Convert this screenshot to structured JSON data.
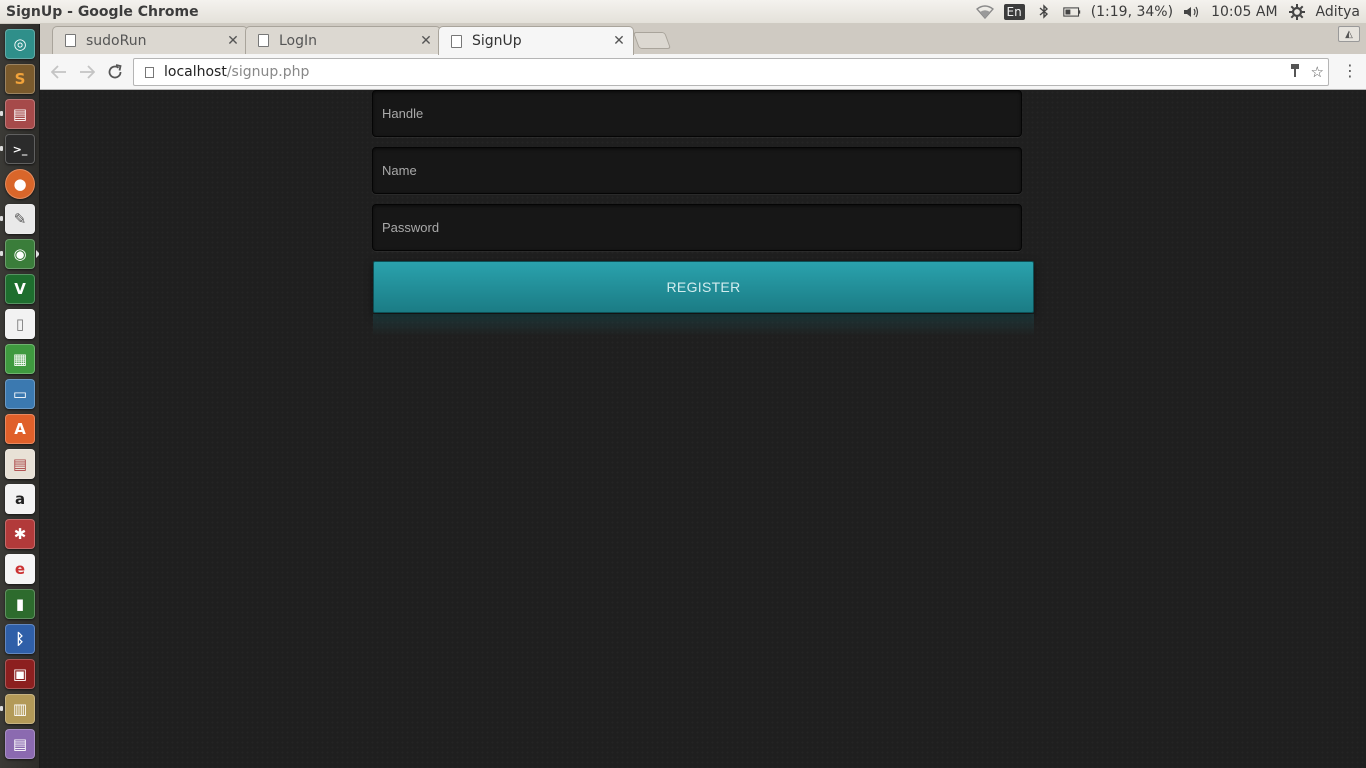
{
  "panel": {
    "window_title": "SignUp - Google Chrome",
    "keyboard_layout": "En",
    "battery": "(1:19, 34%)",
    "clock": "10:05 AM",
    "user": "Aditya"
  },
  "launcher": {
    "items": [
      "dash-icon",
      "sublime-text-icon",
      "file-manager-icon",
      "terminal-icon",
      "firefox-icon",
      "text-editor-icon",
      "chrome-icon",
      "vim-icon",
      "document-icon",
      "spreadsheet-icon",
      "presentation-icon",
      "software-center-icon",
      "document-viewer-icon",
      "amazon-icon",
      "system-settings-icon",
      "ebook-icon",
      "battery-monitor-icon",
      "bluetooth-icon",
      "screenshot-icon",
      "printer-icon",
      "workspace-icon"
    ]
  },
  "tabs": [
    {
      "title": "sudoRun",
      "active": false
    },
    {
      "title": "LogIn",
      "active": false
    },
    {
      "title": "SignUp",
      "active": true
    }
  ],
  "address_bar": {
    "host": "localhost",
    "path": "/signup.php"
  },
  "form": {
    "handle_placeholder": "Handle",
    "name_placeholder": "Name",
    "password_placeholder": "Password",
    "register_label": "REGISTER"
  },
  "colors": {
    "page_background": "#1f1f1f",
    "button_accent": "#2aa2ad"
  }
}
